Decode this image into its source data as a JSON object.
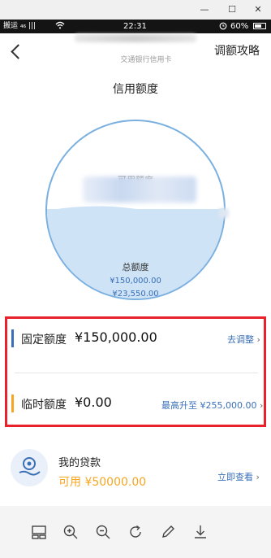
{
  "window": {
    "minimize_glyph": "—",
    "maximize_glyph": "☐",
    "close_glyph": "✕"
  },
  "statusbar": {
    "left_text": "搬运 ₄₆ |||",
    "time": "22:31",
    "battery": "60%"
  },
  "nav": {
    "subtitle": "交通银行信用卡",
    "right_link": "调额攻略"
  },
  "credit": {
    "title": "信用额度",
    "available_label": "可用额度",
    "total_label": "总额度",
    "total_value": "¥150,000.00",
    "second_value": "¥23,550.00"
  },
  "limits": {
    "fixed_label": "固定额度",
    "fixed_value": "¥150,000.00",
    "fixed_link": "去调整",
    "temp_label": "临时额度",
    "temp_value": "¥0.00",
    "temp_link": "最高升至 ¥255,000.00"
  },
  "loan": {
    "title": "我的贷款",
    "amount": "可用 ¥50000.00",
    "link": "立即查看"
  },
  "colors": {
    "accent_blue": "#3a6fb8",
    "highlight_red": "#e8212a",
    "bar_blue": "#3a6fb8",
    "bar_orange": "#f5a623",
    "loan_orange": "#f5a623"
  },
  "icons": {
    "back": "chevron-left-icon",
    "forward": "chevron-right-icon",
    "wifi": "wifi-icon",
    "alarm": "alarm-icon",
    "loan": "coin-hand-icon",
    "tools": [
      "layout-icon",
      "zoom-in-icon",
      "zoom-out-icon",
      "rotate-icon",
      "edit-icon",
      "download-icon"
    ]
  }
}
